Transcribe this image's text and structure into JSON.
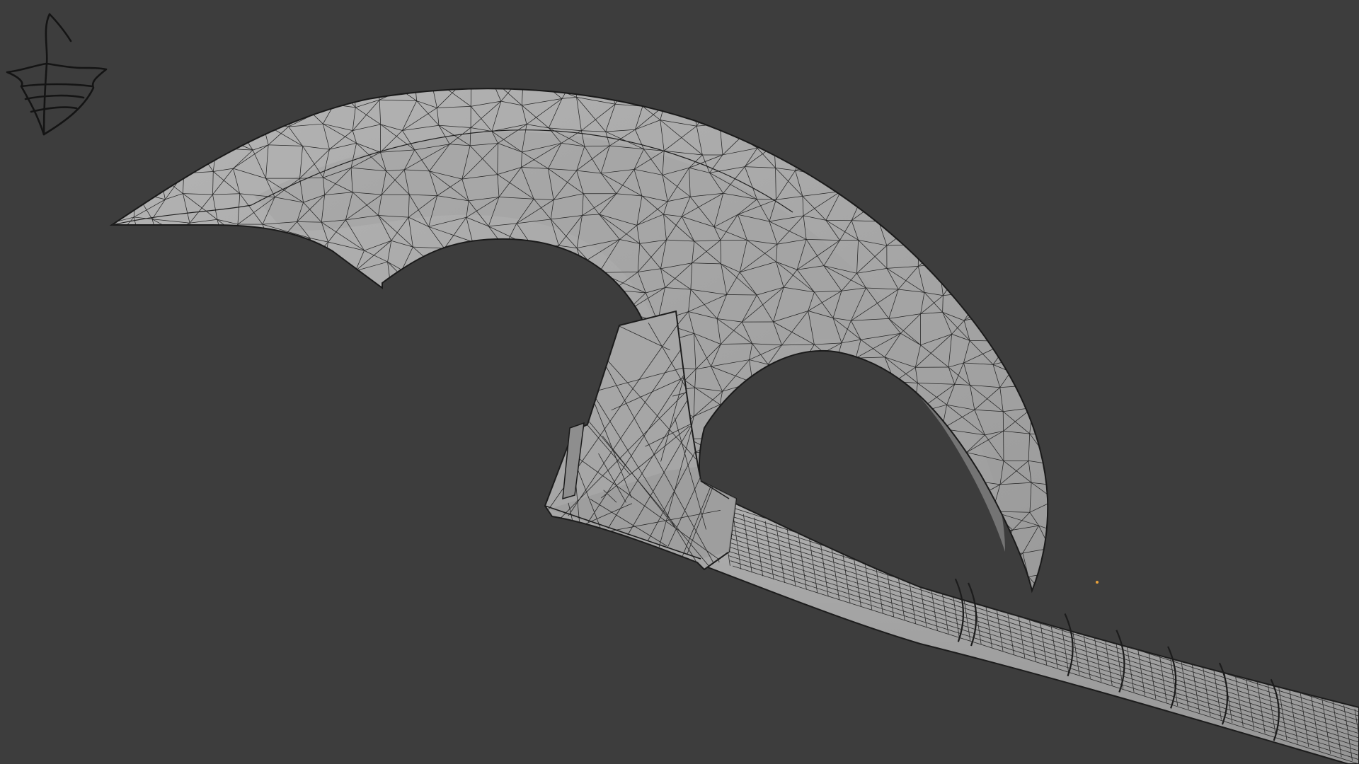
{
  "viewport": {
    "background": "#3d3d3d",
    "mode": "wireframe-overlay",
    "object": "axe"
  },
  "colors": {
    "mesh_fill": "#a9a9a9",
    "mesh_fill_shadow": "#939393",
    "mesh_fill_light": "#b6b6b6",
    "wire": "#1c1c1c",
    "origin_dot": "#e8a13a",
    "signature_ink": "#141414"
  },
  "icons": {
    "signature": "leaf-signature-icon",
    "origin": "origin-point-icon"
  }
}
